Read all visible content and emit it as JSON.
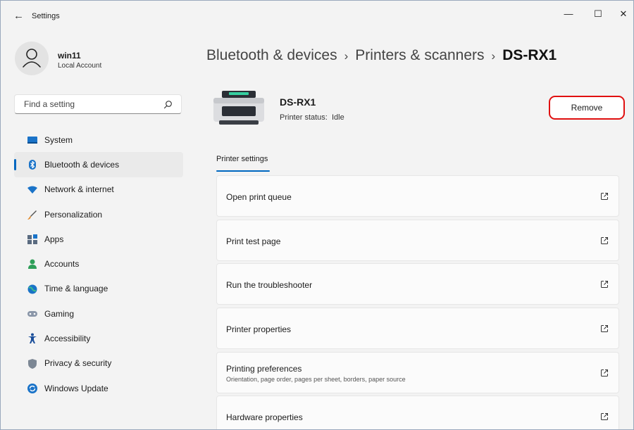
{
  "window": {
    "title": "Settings",
    "back_glyph": "←",
    "minimize_glyph": "—",
    "maximize_glyph": "☐",
    "close_glyph": "✕"
  },
  "user": {
    "name": "win11",
    "account_type": "Local Account"
  },
  "search": {
    "placeholder": "Find a setting",
    "value": ""
  },
  "sidebar": {
    "items": [
      {
        "label": "System",
        "icon": "system-icon"
      },
      {
        "label": "Bluetooth & devices",
        "icon": "bluetooth-icon",
        "selected": true
      },
      {
        "label": "Network & internet",
        "icon": "wifi-icon"
      },
      {
        "label": "Personalization",
        "icon": "brush-icon"
      },
      {
        "label": "Apps",
        "icon": "apps-icon"
      },
      {
        "label": "Accounts",
        "icon": "person-icon"
      },
      {
        "label": "Time & language",
        "icon": "globe-clock-icon"
      },
      {
        "label": "Gaming",
        "icon": "gamepad-icon"
      },
      {
        "label": "Accessibility",
        "icon": "accessibility-icon"
      },
      {
        "label": "Privacy & security",
        "icon": "shield-icon"
      },
      {
        "label": "Windows Update",
        "icon": "update-icon"
      }
    ]
  },
  "breadcrumb": {
    "items": [
      "Bluetooth & devices",
      "Printers & scanners",
      "DS-RX1"
    ],
    "separator": "›"
  },
  "printer": {
    "name": "DS-RX1",
    "status_label": "Printer status:",
    "status_value": "Idle",
    "remove_label": "Remove"
  },
  "tabs": {
    "active": "Printer settings"
  },
  "settings_cards": [
    {
      "title": "Open print queue",
      "subtitle": ""
    },
    {
      "title": "Print test page",
      "subtitle": ""
    },
    {
      "title": "Run the troubleshooter",
      "subtitle": ""
    },
    {
      "title": "Printer properties",
      "subtitle": ""
    },
    {
      "title": "Printing preferences",
      "subtitle": "Orientation, page order, pages per sheet, borders, paper source"
    },
    {
      "title": "Hardware properties",
      "subtitle": ""
    }
  ],
  "colors": {
    "accent": "#0067c0",
    "highlight_border": "#e01010",
    "background": "#f3f3f3",
    "card": "#fbfbfb"
  }
}
